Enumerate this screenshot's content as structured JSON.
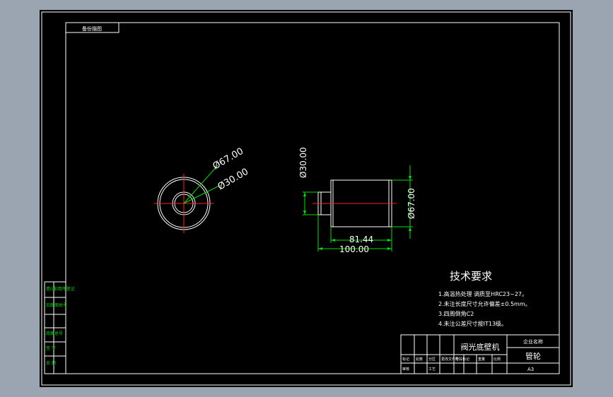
{
  "drawing": {
    "top_label": "备份描图",
    "front_view": {
      "dim_outer": "Ø67.00",
      "dim_inner": "Ø30.00"
    },
    "side_view": {
      "dim_small_dia": "Ø30.00",
      "dim_large_dia": "Ø67.00",
      "dim_length_short": "81.44",
      "dim_length_total": "100.00"
    },
    "tech_requirements": {
      "title": "技术要求",
      "items": [
        "1.高温热处理 调质至HRC23~27。",
        "2.未注长度尺寸允许偏差±0.5mm。",
        "3.四周倒角C2",
        "4.未注公差尺寸按IT13级。"
      ]
    },
    "left_strip": [
      "借(通)用件登记",
      "旧底图总号",
      "底图总号",
      "签 字",
      "日 期"
    ],
    "title_block": {
      "part_name": "阀光底壁机",
      "company": "企业名称",
      "material": "管轮",
      "sheet_size": "A3",
      "row_labels": [
        "标记",
        "处数",
        "分区",
        "更改文件号",
        "签名",
        "年月日"
      ],
      "row2": [
        "设计",
        "标准化",
        "阶段标记",
        "重量",
        "比例"
      ],
      "row3": [
        "审核",
        "工艺",
        "批准"
      ]
    }
  },
  "colors": {
    "background": "#9aa5b1",
    "sheet": "#000000",
    "lines": "#ffffff",
    "dimensions": "#00e000",
    "centerlines": "#ff2020"
  }
}
